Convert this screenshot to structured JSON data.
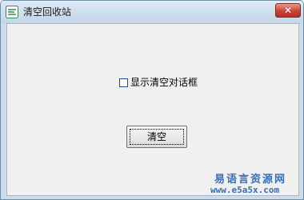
{
  "window": {
    "title": "清空回收站",
    "close_label": "✕",
    "app_icon": "e-language-app-icon"
  },
  "form": {
    "checkbox_label": "显示清空对话框",
    "checkbox_checked": false,
    "clear_button_label": "清空"
  },
  "watermark": {
    "site_name": "易语言资源网",
    "url": "www.e5a5x.com"
  }
}
